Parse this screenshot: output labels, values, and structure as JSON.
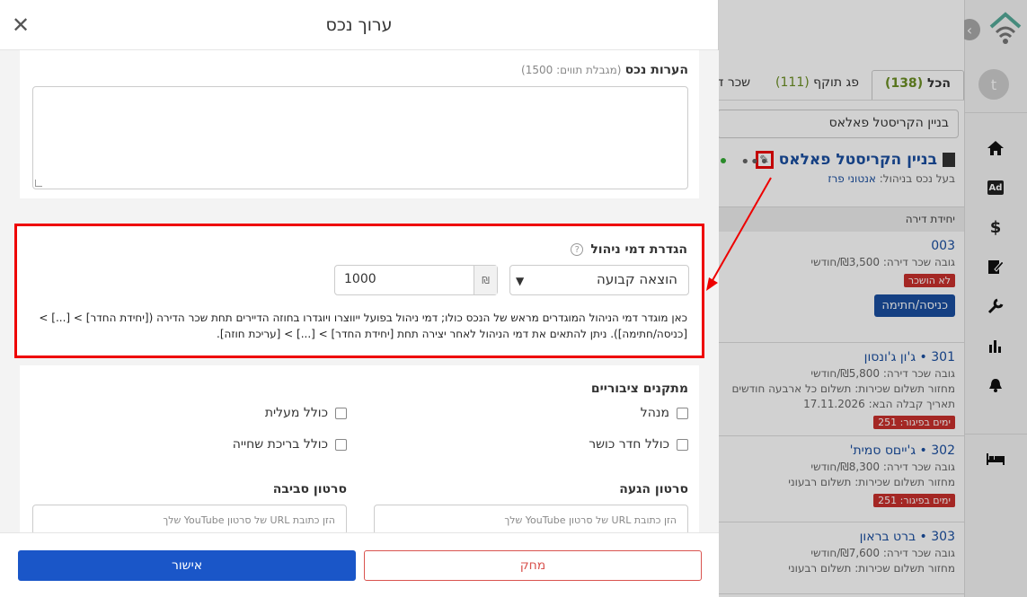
{
  "modal": {
    "title": "ערוך נכס",
    "notes_label": "הערות נכס",
    "notes_limit": "(מגבלת תווים: 1500)",
    "fee_section": {
      "label": "הגדרת דמי ניהול",
      "type_value": "הוצאה קבועה",
      "currency": "₪",
      "amount": "1000",
      "description": "כאן מוגדר דמי הניהול המוגדרים מראש של הנכס כולו; דמי ניהול בפועל ייווצרו ויוגדרו בחוזה הדיירים תחת שכר הדירה ([יחידת החדר] > [...] > [כניסה/חתימה]). ניתן להתאים את דמי הניהול לאחר יצירה תחת [יחידת החדר] > [...] > [עריכת חוזה]."
    },
    "facilities": {
      "label": "מתקנים ציבוריים",
      "items": [
        "מנהל",
        "כולל מעלית",
        "כולל חדר כושר",
        "כולל בריכת שחייה"
      ]
    },
    "video_arrival_label": "סרטון הגעה",
    "video_surroundings_label": "סרטון סביבה",
    "video_placeholder": "הזן כתובת URL של סרטון YouTube שלך",
    "delete_label": "מחק",
    "confirm_label": "אישור"
  },
  "background": {
    "tabs": [
      {
        "label": "הכל",
        "count": "(138)"
      },
      {
        "label": "פג תוקף",
        "count": "(111)"
      },
      {
        "label": "שכר די",
        "count": ""
      }
    ],
    "building_filter": "בניין הקריסטל פאלאס",
    "property": {
      "title": "בניין הקריסטל פאלאס",
      "owner_label": "בעל נכס בניהול:",
      "owner_name": "אנטוני פרז"
    },
    "unit_header": "יחידת דירה",
    "units": [
      {
        "name": "003",
        "rent": "גובה שכר דירה: ₪3,500/חודשי",
        "extra": "",
        "extra2": "",
        "badge": "לא הושכר",
        "button": "כניסה/חתימה"
      },
      {
        "name": "301 • ג'ון ג'ונסון",
        "rent": "גובה שכר דירה: ₪5,800/חודשי",
        "extra": "מחזור תשלום שכירות: תשלום כל ארבעה חודשים",
        "extra2": "תאריך קבלה הבא: 17.11.2026",
        "badge": "ימים בפיגור: 251",
        "button": ""
      },
      {
        "name": "302 • ג'ייםס סמית'",
        "rent": "גובה שכר דירה: ₪8,300/חודשי",
        "extra": "מחזור תשלום שכירות: תשלום רבעוני",
        "extra2": "",
        "badge": "ימים בפיגור: 251",
        "button": ""
      },
      {
        "name": "303 • ברט בראון",
        "rent": "גובה שכר דירה: ₪7,600/חודשי",
        "extra": "מחזור תשלום שכירות: תשלום רבעוני",
        "extra2": "",
        "badge": "",
        "button": ""
      }
    ],
    "user_initial": "t"
  }
}
